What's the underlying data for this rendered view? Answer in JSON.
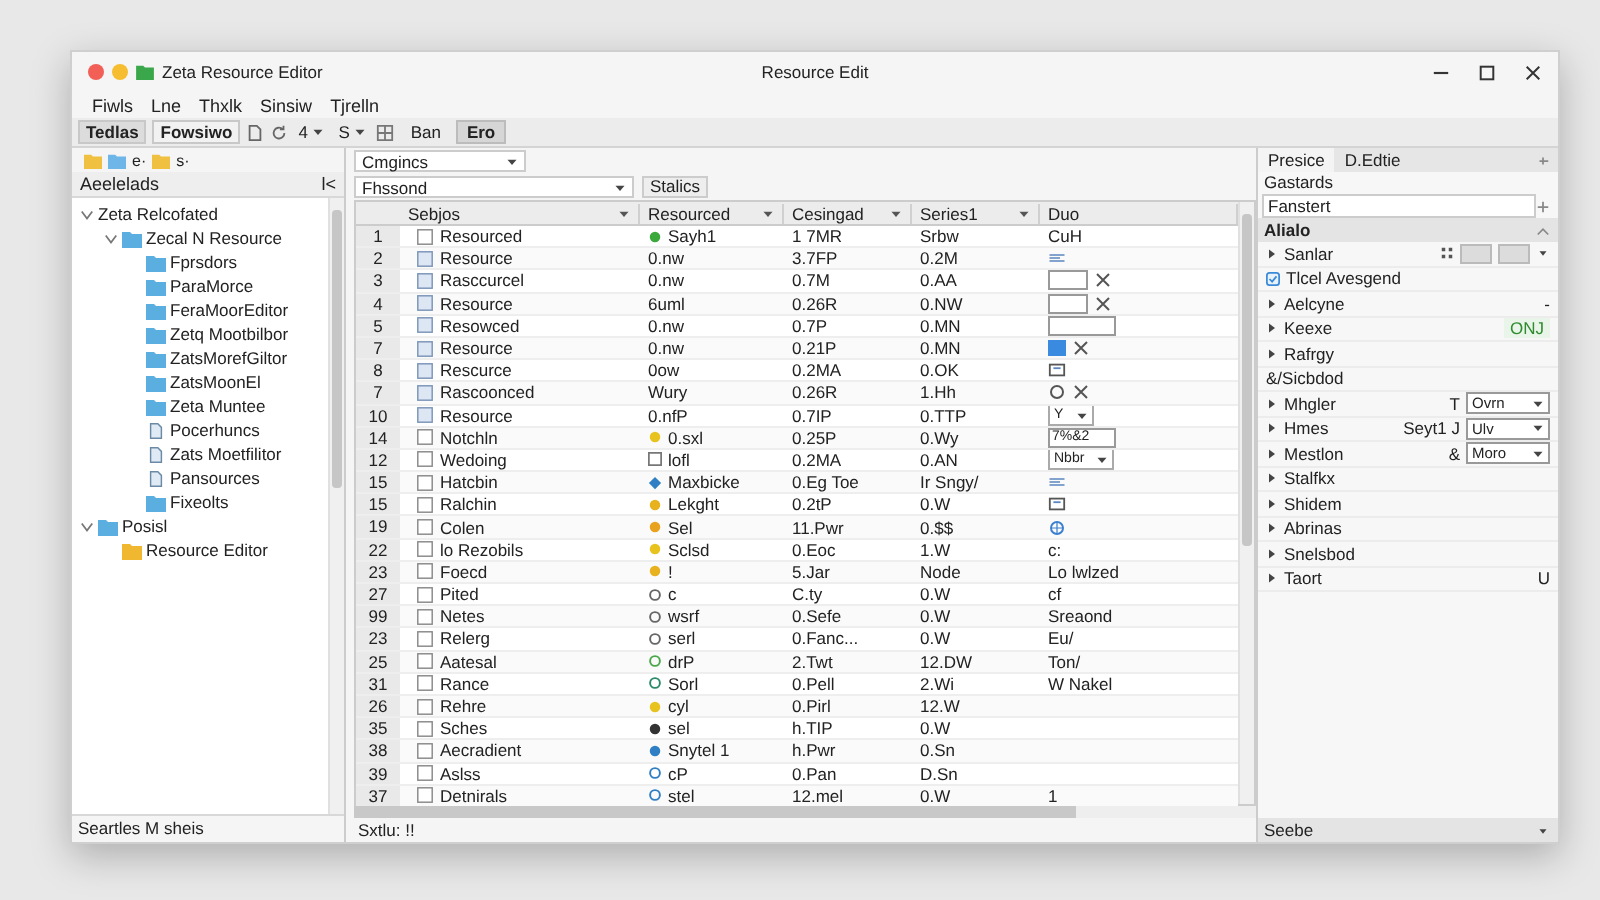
{
  "window": {
    "app_title": "Zeta Resource Editor",
    "title": "Resource Edit"
  },
  "menu": [
    "Fiwls",
    "Lne",
    "Thxlk",
    "Sinsiw",
    "Tjrelln"
  ],
  "toolbar": {
    "tabs": [
      {
        "label": "Tedlas",
        "selected": true
      },
      {
        "label": "Fowsiwo",
        "selected": false
      }
    ],
    "dropdowns": [
      "4",
      "S"
    ],
    "views": [
      {
        "label": "Ban",
        "selected": false
      },
      {
        "label": "Ero",
        "selected": true
      }
    ]
  },
  "explorer": {
    "tool_labels": [
      "e·",
      "s·"
    ],
    "header": "Aeelelads",
    "collapse": "l<",
    "tree": [
      {
        "label": "Zeta Relcofated",
        "kind": "root",
        "expanded": true,
        "children": [
          {
            "label": "Zecal N Resource",
            "kind": "folder",
            "expanded": true,
            "children": [
              {
                "label": "Fprsdors",
                "kind": "folder"
              },
              {
                "label": "ParaMorce",
                "kind": "folder"
              },
              {
                "label": "FeraMoorEditor",
                "kind": "folder"
              },
              {
                "label": "Zetq Mootbilbor",
                "kind": "folder"
              },
              {
                "label": "ZatsMorefGiltor",
                "kind": "folder"
              },
              {
                "label": "ZatsMoonEl",
                "kind": "folder"
              },
              {
                "label": "Zeta Muntee",
                "kind": "folder"
              },
              {
                "label": "Pocerhuncs",
                "kind": "doc"
              },
              {
                "label": "Zats Moetfilitor",
                "kind": "doc"
              },
              {
                "label": "Pansources",
                "kind": "doc"
              },
              {
                "label": "Fixeolts",
                "kind": "folder"
              }
            ]
          }
        ]
      },
      {
        "label": "Posisl",
        "kind": "folder",
        "expanded": true,
        "children": [
          {
            "label": "Resource Editor",
            "kind": "yellow-folder"
          }
        ]
      }
    ],
    "status": "Seartles M sheis"
  },
  "grid": {
    "category": "Cmgincs",
    "filter": "Fhssond",
    "filter_button": "Stalics",
    "columns": [
      "Sebjos",
      "Resourced",
      "Cesingad",
      "Series1",
      "Duo"
    ],
    "rows": [
      {
        "n": "1",
        "name": "Resourced",
        "kind": "box",
        "res": "Sayh1",
        "marker": {
          "kind": "dot",
          "color": "#3aa83a"
        },
        "ces": "1 7MR",
        "ser": "Srbw",
        "duo": {
          "kind": "text",
          "text": "CuH"
        }
      },
      {
        "n": "2",
        "name": "Resource",
        "kind": "file",
        "res": "0.nw",
        "ces": "3.7FP",
        "ser": "0.2M",
        "duo": {
          "kind": "lines"
        }
      },
      {
        "n": "3",
        "name": "Rasccurcel",
        "kind": "file",
        "res": "0.nw",
        "ces": "0.7M",
        "ser": "0.AA",
        "duo": {
          "kind": "field-close"
        }
      },
      {
        "n": "4",
        "name": "Resource",
        "kind": "file",
        "res": "6uml",
        "ces": "0.26R",
        "ser": "0.NW",
        "duo": {
          "kind": "field-close"
        }
      },
      {
        "n": "5",
        "name": "Resowced",
        "kind": "file",
        "res": "0.nw",
        "ces": "0.7P",
        "ser": "0.MN",
        "duo": {
          "kind": "field"
        }
      },
      {
        "n": "7",
        "name": "Resource",
        "kind": "file",
        "res": "0.nw",
        "ces": "0.21P",
        "ser": "0.MN",
        "duo": {
          "kind": "swatch-close"
        }
      },
      {
        "n": "8",
        "name": "Rescurce",
        "kind": "file",
        "res": "0ow",
        "ces": "0.2MA",
        "ser": "0.OK",
        "duo": {
          "kind": "frame"
        }
      },
      {
        "n": "7",
        "name": "Rascoonced",
        "kind": "file",
        "res": "Wury",
        "ces": "0.26R",
        "ser": "1.Hh",
        "duo": {
          "kind": "radio-close"
        }
      },
      {
        "n": "10",
        "name": "Resource",
        "kind": "file",
        "res": "0.nfP",
        "ces": "0.7IP",
        "ser": "0.TTP",
        "duo": {
          "kind": "dropdown",
          "text": "Y"
        }
      },
      {
        "n": "14",
        "name": "Notchln",
        "kind": "box",
        "res": "0.sxl",
        "marker": {
          "kind": "dot",
          "color": "#e8c31e"
        },
        "ces": "0.25P",
        "ser": "0.Wy",
        "duo": {
          "kind": "field",
          "text": "7%&2"
        }
      },
      {
        "n": "12",
        "name": "Wedoing",
        "kind": "box",
        "res": "lofl",
        "marker": {
          "kind": "box",
          "color": "#777777"
        },
        "ces": "0.2MA",
        "ser": "0.AN",
        "duo": {
          "kind": "dropdown",
          "text": "Nbbr"
        }
      },
      {
        "n": "15",
        "name": "Hatcbin",
        "kind": "box",
        "res": "Maxbicke",
        "marker": {
          "kind": "diamond",
          "color": "#2f7fc4"
        },
        "ces": "0.Eg Toe",
        "ser": "Ir Sngy/",
        "duo": {
          "kind": "lines"
        }
      },
      {
        "n": "15",
        "name": "Ralchin",
        "kind": "box",
        "res": "Lekght",
        "marker": {
          "kind": "dot",
          "color": "#e8b21e"
        },
        "ces": "0.2tP",
        "ser": "0.W",
        "duo": {
          "kind": "frame"
        }
      },
      {
        "n": "19",
        "name": "Colen",
        "kind": "box",
        "res": "Sel",
        "marker": {
          "kind": "dot",
          "color": "#e8a21e"
        },
        "ces": "11.Pwr",
        "ser": "0.$$",
        "duo": {
          "kind": "globe"
        }
      },
      {
        "n": "22",
        "name": "lo Rezobils",
        "kind": "box",
        "res": "Sclsd",
        "marker": {
          "kind": "dot",
          "color": "#e8c31e"
        },
        "ces": "0.Eoc",
        "ser": "1.W",
        "duo": {
          "kind": "text",
          "text": "c:"
        }
      },
      {
        "n": "23",
        "name": "Foecd",
        "kind": "box",
        "res": "!",
        "marker": {
          "kind": "dot",
          "color": "#e8b21e"
        },
        "ces": "5.Jar",
        "ser": "Node",
        "duo": {
          "kind": "text",
          "text": "Lo lwlzed"
        }
      },
      {
        "n": "27",
        "name": "Pited",
        "kind": "box",
        "res": "c",
        "marker": {
          "kind": "ring",
          "color": "#666666"
        },
        "ces": "C.ty",
        "ser": "0.W",
        "duo": {
          "kind": "text",
          "text": "cf"
        }
      },
      {
        "n": "99",
        "name": "Netes",
        "kind": "box",
        "res": "wsrf",
        "marker": {
          "kind": "ring",
          "color": "#666666"
        },
        "ces": "0.Sefe",
        "ser": "0.W",
        "duo": {
          "kind": "text",
          "text": "Sreaond"
        }
      },
      {
        "n": "23",
        "name": "Relerg",
        "kind": "box",
        "res": "serl",
        "marker": {
          "kind": "ring",
          "color": "#666666"
        },
        "ces": "0.Fanc...",
        "ser": "0.W",
        "duo": {
          "kind": "text",
          "text": "Eu/"
        }
      },
      {
        "n": "25",
        "name": "Aatesal",
        "kind": "box",
        "res": "drP",
        "marker": {
          "kind": "ring",
          "color": "#4aa84a"
        },
        "ces": "2.Twt",
        "ser": "12.DW",
        "duo": {
          "kind": "text",
          "text": "Ton/"
        }
      },
      {
        "n": "31",
        "name": "Rance",
        "kind": "box",
        "res": "Sorl",
        "marker": {
          "kind": "ring",
          "color": "#2a8a6a"
        },
        "ces": "0.Pell",
        "ser": "2.Wi",
        "duo": {
          "kind": "text",
          "text": "W Nakel"
        }
      },
      {
        "n": "26",
        "name": "Rehre",
        "kind": "box",
        "res": "cyl",
        "marker": {
          "kind": "dot",
          "color": "#e8c31e"
        },
        "ces": "0.Pirl",
        "ser": "12.W"
      },
      {
        "n": "35",
        "name": "Sches",
        "kind": "box",
        "res": "sel",
        "marker": {
          "kind": "dot",
          "color": "#333333"
        },
        "ces": "h.TIP",
        "ser": "0.W"
      },
      {
        "n": "38",
        "name": "Aecradient",
        "kind": "box",
        "res": "Snytel 1",
        "marker": {
          "kind": "dot",
          "color": "#2f7fc4"
        },
        "ces": "h.Pwr",
        "ser": "0.Sn"
      },
      {
        "n": "39",
        "name": "Aslss",
        "kind": "box",
        "res": "cP",
        "marker": {
          "kind": "ring",
          "color": "#2f7fc4"
        },
        "ces": "0.Pan",
        "ser": "D.Sn"
      },
      {
        "n": "37",
        "name": "Detnirals",
        "kind": "box",
        "res": "stel",
        "marker": {
          "kind": "ring",
          "color": "#2f7fc4"
        },
        "ces": "12.mel",
        "ser": "0.W",
        "duo": {
          "kind": "text",
          "text": "1"
        }
      }
    ],
    "status": "Sxtlu: !!"
  },
  "inspector": {
    "tabs": [
      {
        "label": "Presice",
        "selected": true
      },
      {
        "label": "D.Edtie",
        "selected": false
      }
    ],
    "subtitle": "Gastards",
    "search": "Fanstert",
    "section": "Alialo",
    "properties": [
      {
        "label": "Sanlar",
        "kind": "swatches",
        "expandable": true
      },
      {
        "label": "Tlcel Avesgend",
        "kind": "checkbox",
        "checked": true,
        "expandable": false
      },
      {
        "label": "Aelcyne",
        "kind": "value",
        "value": "-",
        "expandable": true
      },
      {
        "label": "Keexe",
        "kind": "status",
        "value": "ONJ",
        "expandable": true
      },
      {
        "label": "Rafrgy",
        "kind": "plain",
        "expandable": true
      },
      {
        "label": "&/Sicbdod",
        "kind": "plain",
        "expandable": false
      },
      {
        "label": "Mhgler",
        "kind": "dropdown",
        "note": "T",
        "value": "Ovrn",
        "expandable": true
      },
      {
        "label": "Hmes",
        "kind": "dropdown",
        "note": "Seyt1 J",
        "value": "Ulv",
        "expandable": true
      },
      {
        "label": "Mestlon",
        "kind": "dropdown",
        "note": "&",
        "value": "Moro",
        "expandable": true
      },
      {
        "label": "Stalfkx",
        "kind": "plain",
        "expandable": true
      },
      {
        "label": "Shidem",
        "kind": "plain",
        "expandable": true
      },
      {
        "label": "Abrinas",
        "kind": "plain",
        "expandable": true
      },
      {
        "label": "Snelsbod",
        "kind": "plain",
        "expandable": true
      },
      {
        "label": "Taort",
        "kind": "value",
        "value": "U",
        "expandable": true
      }
    ],
    "footer": "Seebe"
  }
}
